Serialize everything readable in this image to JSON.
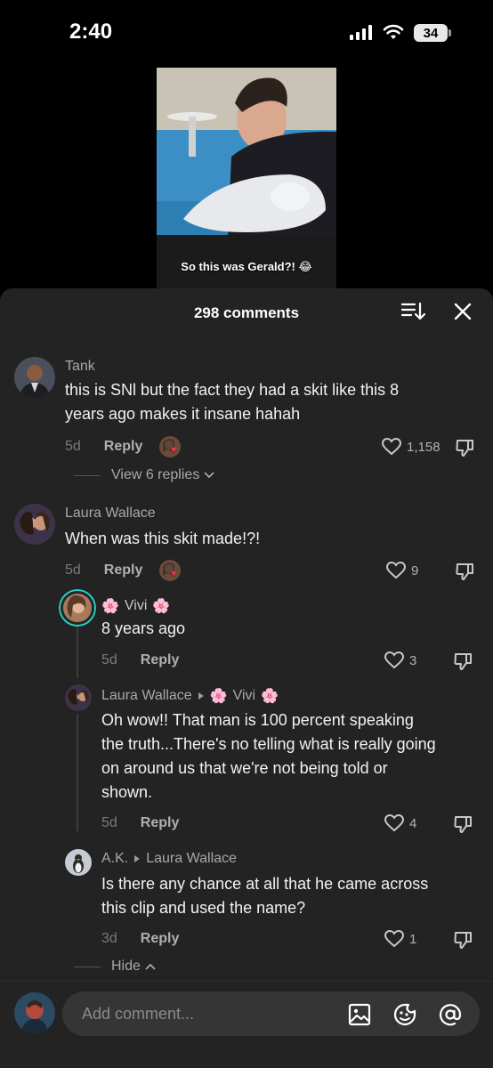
{
  "status_bar": {
    "time": "2:40",
    "battery": "34"
  },
  "video": {
    "caption": "So this was Gerald?! 😂"
  },
  "sheet": {
    "title": "298 comments"
  },
  "comments": [
    {
      "username": "Tank",
      "text_lines": [
        "this is SNl but the fact they had a skit like this 8",
        "years ago makes it insane hahah"
      ],
      "age": "5d",
      "reply_label": "Reply",
      "likes": "1,158",
      "view_replies": "View 6 replies"
    },
    {
      "username": "Laura Wallace",
      "text_lines": [
        "When was this skit made!?!"
      ],
      "age": "5d",
      "reply_label": "Reply",
      "likes": "9",
      "replies": [
        {
          "username": "Vivi",
          "text_lines": [
            "8 years ago"
          ],
          "age": "5d",
          "reply_label": "Reply",
          "likes": "3"
        },
        {
          "username": "Laura Wallace",
          "reply_to": "Vivi",
          "text_lines": [
            "Oh wow!! That man is 100 percent speaking",
            "the truth...There's no telling what is really going",
            "on around us that we're not being told or",
            "shown."
          ],
          "age": "5d",
          "reply_label": "Reply",
          "likes": "4"
        },
        {
          "username": "A.K.",
          "reply_to": "Laura Wallace",
          "text_lines": [
            "Is there any chance at all that he came across",
            "this clip and used the name?"
          ],
          "age": "3d",
          "reply_label": "Reply",
          "likes": "1"
        }
      ],
      "hide_label": "Hide"
    }
  ],
  "input": {
    "placeholder": "Add comment..."
  },
  "icons": [
    "signal-icon",
    "wifi-icon",
    "battery-icon",
    "sort-icon",
    "close-icon",
    "heart-icon",
    "dislike-icon",
    "chevron-down-icon",
    "chevron-up-icon",
    "image-icon",
    "emoji-icon",
    "mention-icon"
  ],
  "colors": {
    "sheet_bg": "#232323",
    "input_bg": "#353535",
    "story_ring": "#25d3c8",
    "like_red": "#fe2c55"
  }
}
